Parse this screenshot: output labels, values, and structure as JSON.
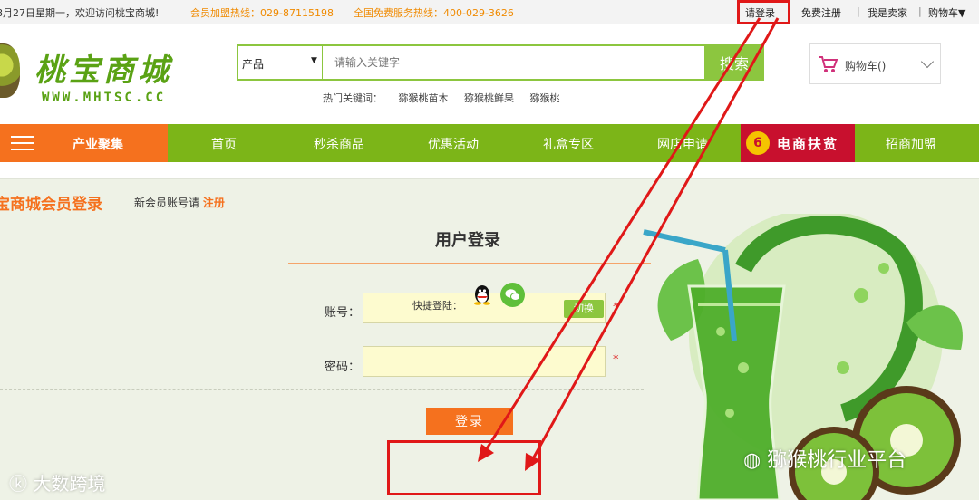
{
  "topbar": {
    "welcome": "8月27日星期一，欢迎访问桃宝商城!",
    "hotline_member": "会员加盟热线：029-87115198",
    "hotline_service": "全国免费服务热线：400-029-3626",
    "login": "请登录",
    "register": "免费注册",
    "separator": "|",
    "seller": "我是卖家",
    "cart": "购物车▼"
  },
  "header": {
    "logo_text": "桃宝商城",
    "logo_url": "WWW.MHTSC.CC",
    "search_category": "产品",
    "search_placeholder": "请输入关键字",
    "search_button": "搜索",
    "hot_label": "热门关键词：",
    "hot_keywords": [
      "猕猴桃苗木",
      "猕猴桃鲜果",
      "猕猴桃"
    ],
    "cart_label": "购物车()"
  },
  "nav": {
    "category": "产业聚集",
    "items": [
      "首页",
      "秒杀商品",
      "优惠活动",
      "礼盒专区",
      "网店申请"
    ],
    "poverty": "电商扶贫",
    "join": "招商加盟"
  },
  "main": {
    "page_title": "宝商城会员登录",
    "new_member_text": "新会员账号请",
    "register_link": "注册",
    "form_title": "用户登录",
    "account_label": "账号：",
    "password_label": "密码：",
    "switch_label": "切换",
    "required_mark": "*",
    "login_button": "登录",
    "quick_login_label": "快捷登陆："
  },
  "watermarks": {
    "left": "大数跨境",
    "right": "猕猴桃行业平台"
  },
  "colors": {
    "brand_green": "#7cb518",
    "accent_orange": "#f5711e",
    "annotation_red": "#e01818"
  }
}
